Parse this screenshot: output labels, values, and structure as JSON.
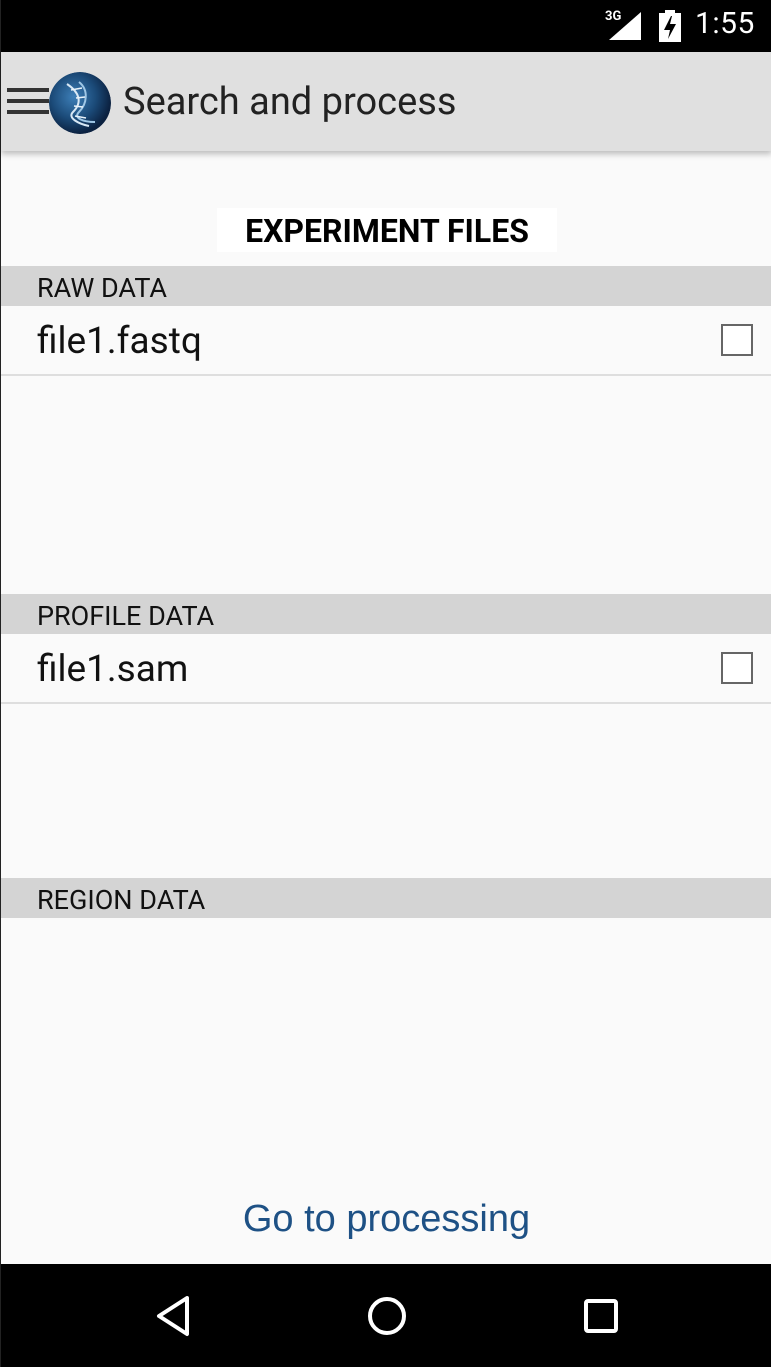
{
  "status_bar": {
    "network": "3G",
    "time": "1:55"
  },
  "toolbar": {
    "title": "Search and process"
  },
  "heading": "EXPERIMENT FILES",
  "sections": {
    "raw": {
      "label": "RAW DATA",
      "files": [
        "file1.fastq"
      ]
    },
    "profile": {
      "label": "PROFILE DATA",
      "files": [
        "file1.sam"
      ]
    },
    "region": {
      "label": "REGION DATA",
      "files": []
    }
  },
  "action": {
    "go_label": "Go to processing"
  },
  "colors": {
    "accent": "#1e5185",
    "toolbar_bg": "#e0e0e0",
    "section_bg": "#d4d4d4",
    "page_bg": "#fafafa"
  },
  "icons": [
    "signal-icon",
    "battery-icon",
    "menu-icon",
    "app-logo-icon",
    "back-icon",
    "home-icon",
    "recents-icon"
  ]
}
